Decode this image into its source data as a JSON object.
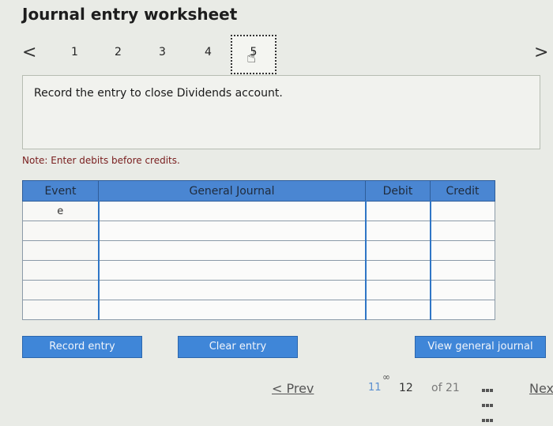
{
  "header": {
    "title": "Journal entry worksheet"
  },
  "steps": {
    "left_arrow": "<",
    "right_arrow": ">",
    "items": [
      "1",
      "2",
      "3",
      "4",
      "5"
    ],
    "active_index": 4
  },
  "prompt": {
    "text": "Record the entry to close Dividends account."
  },
  "note": {
    "text": "Note: Enter debits before credits."
  },
  "table": {
    "headers": [
      "Event",
      "General Journal",
      "Debit",
      "Credit"
    ],
    "rows": [
      {
        "event": "e",
        "general_journal": "",
        "debit": "",
        "credit": ""
      },
      {
        "event": "",
        "general_journal": "",
        "debit": "",
        "credit": ""
      },
      {
        "event": "",
        "general_journal": "",
        "debit": "",
        "credit": ""
      },
      {
        "event": "",
        "general_journal": "",
        "debit": "",
        "credit": ""
      },
      {
        "event": "",
        "general_journal": "",
        "debit": "",
        "credit": ""
      },
      {
        "event": "",
        "general_journal": "",
        "debit": "",
        "credit": ""
      }
    ]
  },
  "buttons": {
    "record": "Record entry",
    "clear": "Clear entry",
    "view": "View general journal"
  },
  "pager": {
    "prev": "< Prev",
    "page_11": "11",
    "page_12": "12",
    "of_total": "of 21",
    "next": "Nex"
  },
  "colors": {
    "accent": "#3f86d8",
    "table_header": "#4a86d2",
    "note": "#7a2020",
    "background": "#e9ebe6"
  }
}
